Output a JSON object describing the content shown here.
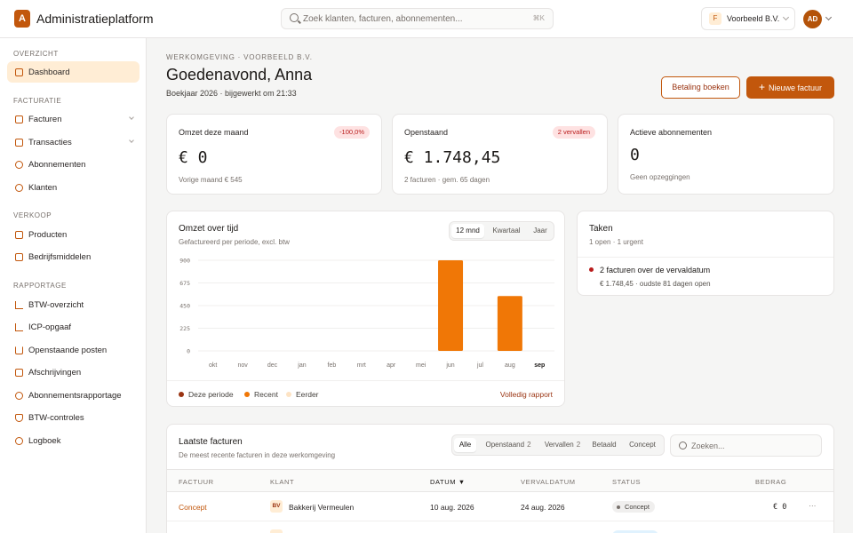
{
  "app": {
    "logo_letter": "A",
    "title": "Administratieplatform"
  },
  "search": {
    "placeholder": "Zoek klanten, facturen, abonnementen...",
    "shortcut": "⌘K"
  },
  "org": {
    "badge": "F",
    "name": "Voorbeeld B.V."
  },
  "user": {
    "initials": "AD"
  },
  "sidebar": {
    "sections": [
      {
        "label": "OVERZICHT"
      },
      {
        "label": "FACTURATIE"
      },
      {
        "label": "VERKOOP"
      },
      {
        "label": "RAPPORTAGE"
      }
    ],
    "items": [
      {
        "label": "Dashboard",
        "icon": "dashboard-icon",
        "active": true
      },
      {
        "label": "Facturen",
        "icon": "invoice-icon",
        "expandable": true
      },
      {
        "label": "Transacties",
        "icon": "card-icon",
        "expandable": true
      },
      {
        "label": "Abonnementen",
        "icon": "refresh-icon"
      },
      {
        "label": "Klanten",
        "icon": "users-icon"
      },
      {
        "label": "Producten",
        "icon": "box-icon"
      },
      {
        "label": "Bedrijfsmiddelen",
        "icon": "building-icon"
      },
      {
        "label": "BTW-overzicht",
        "icon": "bar-chart-icon"
      },
      {
        "label": "ICP-opgaaf",
        "icon": "bar-chart-icon"
      },
      {
        "label": "Openstaande posten",
        "icon": "warning-icon"
      },
      {
        "label": "Afschrijvingen",
        "icon": "document-icon"
      },
      {
        "label": "Abonnementsrapportage",
        "icon": "refresh-icon"
      },
      {
        "label": "BTW-controles",
        "icon": "shield-icon"
      },
      {
        "label": "Logboek",
        "icon": "eye-off-icon"
      }
    ]
  },
  "header": {
    "breadcrumb": "WERKOMGEVING · VOORBEELD B.V.",
    "greeting": "Goedenavond, Anna",
    "subline": "Boekjaar 2026 · bijgewerkt om 21:33",
    "secondary_button": "Betaling boeken",
    "primary_button": "Nieuwe factuur"
  },
  "kpis": [
    {
      "title": "Omzet deze maand",
      "value": "€ 0",
      "sub": "Vorige maand € 545",
      "badge": "-100,0%"
    },
    {
      "title": "Openstaand",
      "value": "€ 1.748,45",
      "sub": "2 facturen · gem. 65 dagen",
      "badge": "2 vervallen"
    },
    {
      "title": "Actieve abonnementen",
      "value": "0",
      "sub": "Geen opzeggingen",
      "badge": ""
    }
  ],
  "revenue_card": {
    "title": "Omzet over tijd",
    "subtitle": "Gefactureerd per periode, excl. btw",
    "ranges": [
      "12 mnd",
      "Kwartaal",
      "Jaar"
    ],
    "active_range": "12 mnd",
    "legend": [
      "Deze periode",
      "Recent",
      "Eerder"
    ],
    "full_report": "Volledig rapport"
  },
  "colors": {
    "accent": "#c2570c",
    "bar": "#f07706",
    "this_period": "#9a3412",
    "recent": "#f07706",
    "earlier": "#fde3c4"
  },
  "chart_data": {
    "type": "bar",
    "categories": [
      "okt",
      "nov",
      "dec",
      "jan",
      "feb",
      "mrt",
      "apr",
      "mei",
      "jun",
      "jul",
      "aug",
      "sep"
    ],
    "values": [
      0,
      0,
      0,
      0,
      0,
      0,
      0,
      0,
      900,
      0,
      545,
      0
    ],
    "yticks": [
      0,
      225,
      450,
      675,
      900
    ],
    "ylim": [
      0,
      900
    ],
    "current_category": "sep",
    "grid": true,
    "legend_position": "bottom"
  },
  "tasks": {
    "title": "Taken",
    "subtitle": "1 open · 1 urgent",
    "items": [
      {
        "title": "2 facturen over de vervaldatum",
        "detail": "€ 1.748,45 · oudste 81 dagen open"
      }
    ]
  },
  "invoices": {
    "title": "Laatste facturen",
    "subtitle": "De meest recente facturen in deze werkomgeving",
    "filters": [
      {
        "label": "Alle",
        "count": ""
      },
      {
        "label": "Openstaand",
        "count": "2"
      },
      {
        "label": "Vervallen",
        "count": "2"
      },
      {
        "label": "Betaald",
        "count": ""
      },
      {
        "label": "Concept",
        "count": ""
      }
    ],
    "search_placeholder": "Zoeken...",
    "columns": [
      "FACTUUR",
      "KLANT",
      "DATUM ▼",
      "VERVALDATUM",
      "STATUS",
      "BEDRAG"
    ],
    "rows": [
      {
        "invoice": "Concept",
        "initials": "BV",
        "customer": "Bakkerij Vermeulen",
        "date": "10 aug. 2026",
        "due": "24 aug. 2026",
        "status": "Concept",
        "amount": "€ 0",
        "menu": "···"
      }
    ]
  }
}
